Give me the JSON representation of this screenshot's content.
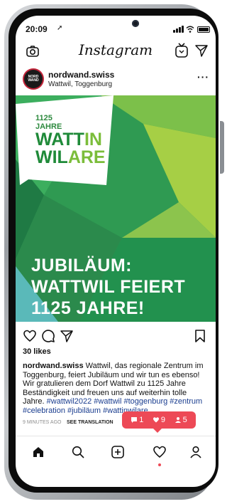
{
  "status": {
    "time": "20:09",
    "location_arrow": "➚"
  },
  "app": {
    "title": "Instagram"
  },
  "post": {
    "username": "nordwand.swiss",
    "location": "Wattwil, Toggenburg",
    "avatar_text": [
      "NORD",
      "WAND"
    ],
    "more": "···",
    "image": {
      "badge_years": [
        "1125",
        "JAHRE"
      ],
      "badge_big": [
        "WATT",
        "IN",
        "WIL",
        "ARE"
      ],
      "headline": [
        "JUBILÄUM:",
        "WATTWIL FEIERT",
        "1125 JAHRE!"
      ]
    },
    "likes": "30 likes",
    "caption_user": "nordwand.swiss",
    "caption_text": " Wattwil, das regionale Zentrum im Toggenburg, feiert Jubiläum und wir tun es ebenso! Wir gratulieren dem Dorf Wattwil zu 1125 Jahre Beständigkeit und freuen uns auf weiterhin tolle Jahre. ",
    "caption_tags": "#wattwil2022 #wattwil #toggenburg #zentrum #celebration #jubiläum #wattinwilare",
    "time_ago": "9 MINUTES AGO",
    "translate": "SEE TRANSLATION"
  },
  "notifications": {
    "comments": "1",
    "likes": "9",
    "followers": "5"
  },
  "colors": {
    "accent": "#ed4956",
    "hashtag": "#1a3d8f",
    "green_dark": "#1f8a39",
    "green_light": "#7bbd3a"
  },
  "icons": [
    "camera-icon",
    "igtv-icon",
    "send-icon",
    "heart-icon",
    "comment-icon",
    "share-icon",
    "bookmark-icon",
    "home-icon",
    "search-icon",
    "add-icon",
    "activity-icon",
    "profile-icon"
  ]
}
